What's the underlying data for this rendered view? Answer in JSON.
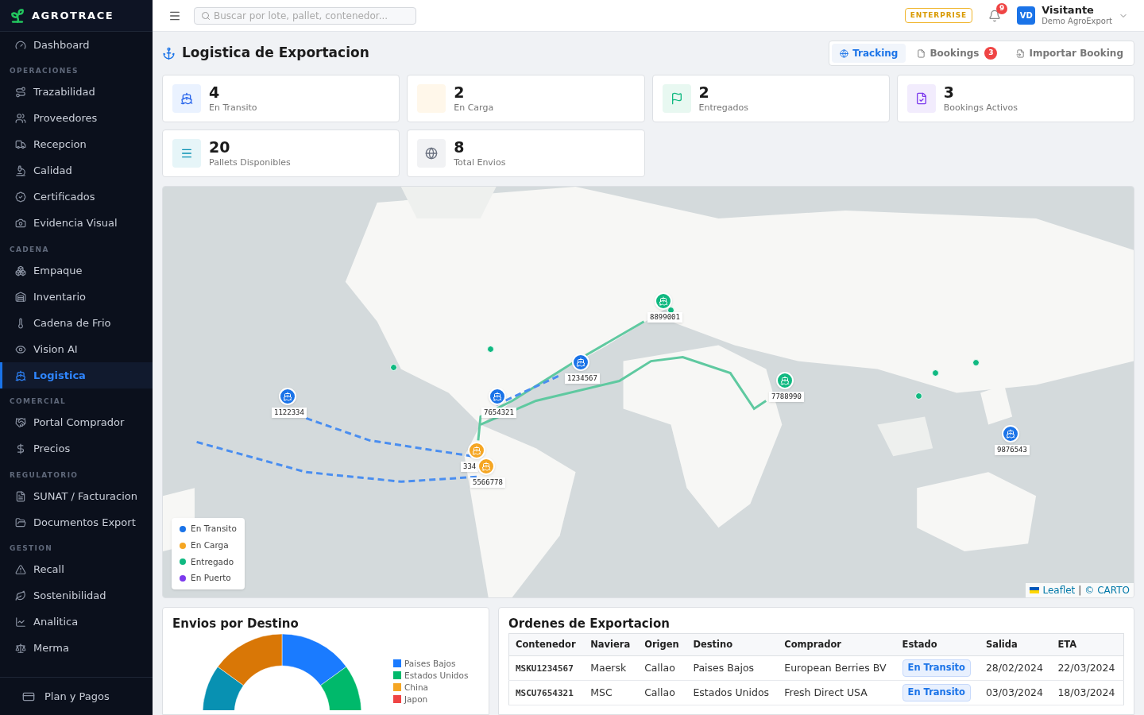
{
  "brand": {
    "name": "AGROTRACE"
  },
  "sidebar": {
    "sections": [
      {
        "items": [
          {
            "label": "Dashboard",
            "selected": false
          }
        ]
      },
      {
        "title": "OPERACIONES",
        "items": [
          {
            "label": "Trazabilidad",
            "selected": false
          },
          {
            "label": "Proveedores",
            "selected": false
          },
          {
            "label": "Recepcion",
            "selected": false
          },
          {
            "label": "Calidad",
            "selected": false
          },
          {
            "label": "Certificados",
            "selected": false
          },
          {
            "label": "Evidencia Visual",
            "selected": false
          }
        ]
      },
      {
        "title": "CADENA",
        "items": [
          {
            "label": "Empaque",
            "selected": false
          },
          {
            "label": "Inventario",
            "selected": false
          },
          {
            "label": "Cadena de Frio",
            "selected": false
          },
          {
            "label": "Vision AI",
            "selected": false
          },
          {
            "label": "Logistica",
            "selected": true
          }
        ]
      },
      {
        "title": "COMERCIAL",
        "items": [
          {
            "label": "Portal Comprador",
            "selected": false
          },
          {
            "label": "Precios",
            "selected": false
          }
        ]
      },
      {
        "title": "REGULATORIO",
        "items": [
          {
            "label": "SUNAT / Facturacion",
            "selected": false
          },
          {
            "label": "Documentos Export",
            "selected": false
          }
        ]
      },
      {
        "title": "GESTION",
        "items": [
          {
            "label": "Recall",
            "selected": false
          },
          {
            "label": "Sostenibilidad",
            "selected": false
          },
          {
            "label": "Analitica",
            "selected": false
          },
          {
            "label": "Merma",
            "selected": false
          }
        ]
      }
    ],
    "footer": "Plan y Pagos"
  },
  "topbar": {
    "search": {
      "placeholder": "Buscar por lote, pallet, contenedor..."
    },
    "plan": "ENTERPRISE",
    "notifications": "9",
    "user": {
      "initials": "VD",
      "name": "Visitante",
      "company": "Demo AgroExport"
    }
  },
  "page": {
    "title": "Logistica de Exportacion",
    "tabs": [
      {
        "label": "Tracking",
        "selected": true
      },
      {
        "label": "Bookings",
        "selected": false,
        "badge": "3"
      },
      {
        "label": "Importar Booking",
        "selected": false
      }
    ]
  },
  "stats": [
    {
      "value": "4",
      "label": "En Transito",
      "color": "#eaf2ff"
    },
    {
      "value": "2",
      "label": "En Carga",
      "color": "#fff7ea"
    },
    {
      "value": "2",
      "label": "Entregados",
      "color": "#e8f8f1"
    },
    {
      "value": "3",
      "label": "Bookings Activos",
      "color": "#f2ecfd"
    },
    {
      "value": "20",
      "label": "Pallets Disponibles",
      "color": "#e6f5f8"
    },
    {
      "value": "8",
      "label": "Total Envios",
      "color": "#f1f2f4"
    }
  ],
  "map": {
    "kind": "picture",
    "markers": [
      {
        "label": "8899001",
        "color": "#10b981"
      },
      {
        "label": "1234567",
        "color": "#1a73e8"
      },
      {
        "label": "7788990",
        "color": "#10b981"
      },
      {
        "label": "1122334",
        "color": "#1a73e8"
      },
      {
        "label": "7654321",
        "color": "#1a73e8"
      },
      {
        "label": "9876543",
        "color": "#1a73e8"
      },
      {
        "label": "334",
        "color": "#f5a623"
      },
      {
        "label": "5566778",
        "color": "#f5a623"
      }
    ],
    "legend": [
      {
        "label": "En Transito",
        "color": "#1a73e8"
      },
      {
        "label": "En Carga",
        "color": "#f5a623"
      },
      {
        "label": "Entregado",
        "color": "#10b981"
      },
      {
        "label": "En Puerto",
        "color": "#7c3aed"
      }
    ],
    "attribution": {
      "leaflet": "Leaflet",
      "separator": "|",
      "carto": "© CARTO"
    }
  },
  "destinations": {
    "title": "Envios por Destino",
    "legend": [
      {
        "label": "Paises Bajos",
        "color": "#1a7bff"
      },
      {
        "label": "Estados Unidos",
        "color": "#00b96b"
      },
      {
        "label": "China",
        "color": "#f5a623"
      },
      {
        "label": "Japon",
        "color": "#ef4444"
      }
    ]
  },
  "orders": {
    "title": "Ordenes de Exportacion",
    "columns": [
      "Contenedor",
      "Naviera",
      "Origen",
      "Destino",
      "Comprador",
      "Estado",
      "Salida",
      "ETA"
    ],
    "rows": [
      [
        "MSKU1234567",
        "Maersk",
        "Callao",
        "Paises Bajos",
        "European Berries BV",
        "En Transito",
        "28/02/2024",
        "22/03/2024"
      ],
      [
        "MSCU7654321",
        "MSC",
        "Callao",
        "Estados Unidos",
        "Fresh Direct USA",
        "En Transito",
        "03/03/2024",
        "18/03/2024"
      ]
    ]
  }
}
